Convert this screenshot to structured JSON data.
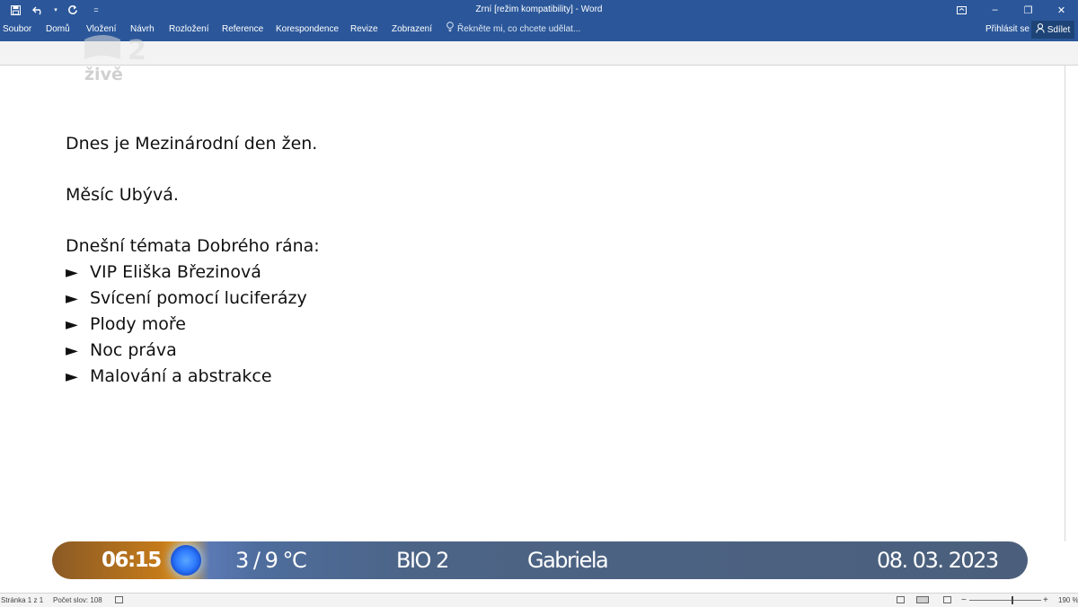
{
  "window": {
    "title": "Zrní [režim kompatibility] - Word",
    "minimize_glyph": "–",
    "restore_glyph": "❐",
    "close_glyph": "✕",
    "customize_glyph": "="
  },
  "ribbon": {
    "tabs": [
      "Soubor",
      "Domů",
      "Vložení",
      "Návrh",
      "Rozložení",
      "Reference",
      "Korespondence",
      "Revize",
      "Zobrazení"
    ],
    "tell_me_placeholder": "Řekněte mi, co chcete udělat...",
    "sign_in": "Přihlásit se",
    "share": "Sdílet"
  },
  "logo": {
    "text": "živě",
    "mark_text": "2"
  },
  "document": {
    "line1": "Dnes je Mezinárodní den žen.",
    "line2": "Měsíc Ubývá.",
    "topics_heading": "Dnešní témata Dobrého rána:",
    "bullet_glyph": "►",
    "topics": [
      "VIP Eliška Březinová",
      "Svícení pomocí luciferázy",
      "Plody moře",
      "Noc práva",
      "Malování a abstrakce"
    ]
  },
  "ticker": {
    "time": "06:15",
    "temperature": "3 / 9 °C",
    "channel": "BIO 2",
    "name_day": "Gabriela",
    "date": "08. 03. 2023",
    "colors": {
      "left_accent": "#c47a1a",
      "bar": "#4b5f7c",
      "orb": "#2f7bff"
    }
  },
  "status": {
    "page": "Stránka 1 z 1",
    "word_count": "Počet slov: 108",
    "zoom": "190 %",
    "zoom_minus": "−",
    "zoom_plus": "+",
    "zoom_level": 0.6
  },
  "colors": {
    "word_blue": "#2b579a",
    "share_bg": "#1e4477"
  }
}
